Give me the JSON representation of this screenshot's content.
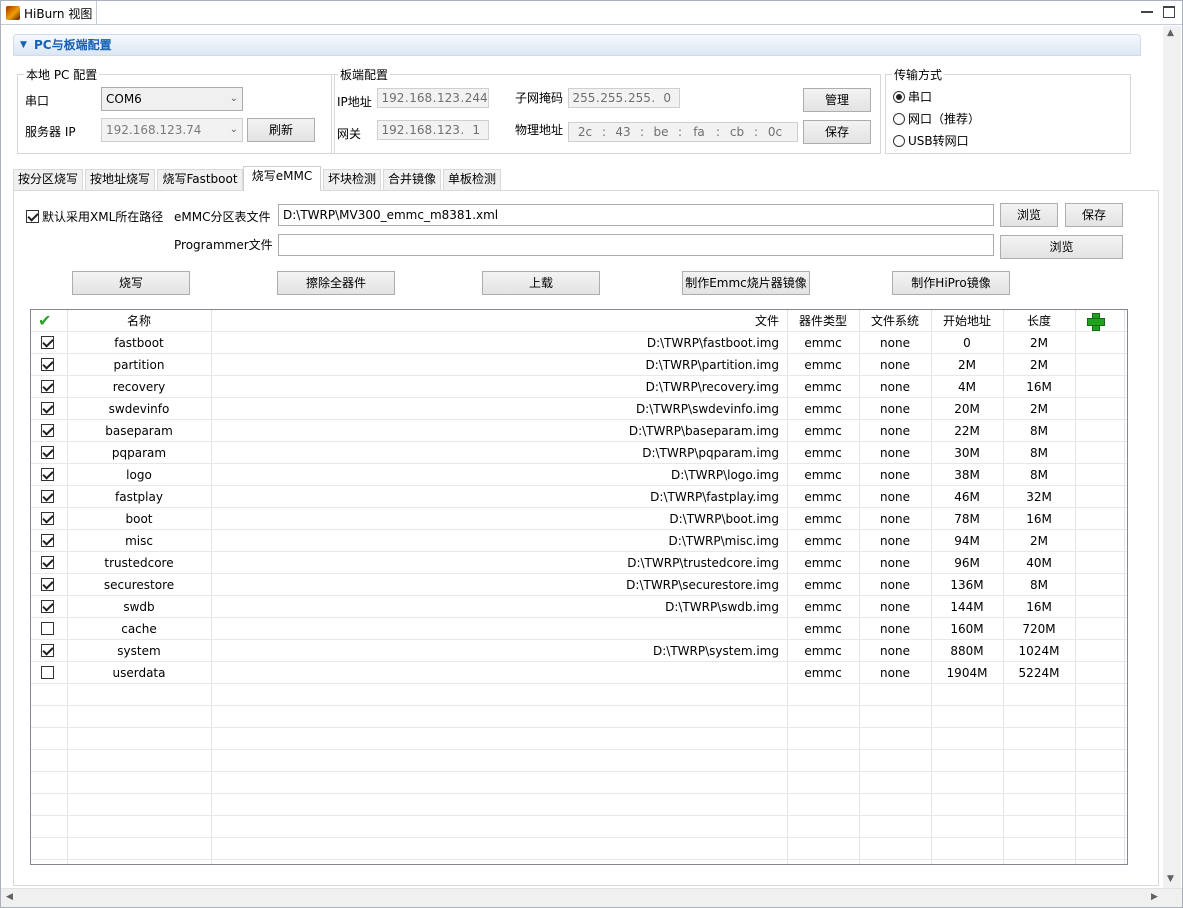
{
  "window": {
    "title": "HiBurn 视图"
  },
  "section": {
    "title": "PC与板端配置"
  },
  "local": {
    "legend": "本地 PC 配置",
    "serial_label": "串口",
    "serial_value": "COM6",
    "server_label": "服务器 IP",
    "server_value": "192.168.123.74",
    "refresh": "刷新"
  },
  "board": {
    "legend": "板端配置",
    "ip_label": "IP地址",
    "ip": [
      "192",
      "168",
      "123",
      "244"
    ],
    "gw_label": "网关",
    "gw": [
      "192",
      "168",
      "123",
      "1"
    ],
    "mask_label": "子网掩码",
    "mask": [
      "255",
      "255",
      "255",
      "0"
    ],
    "mac_label": "物理地址",
    "mac": [
      "2c",
      "43",
      "be",
      "fa",
      "cb",
      "0c"
    ],
    "manage": "管理",
    "save": "保存"
  },
  "transfer": {
    "legend": "传输方式",
    "options": [
      "串口",
      "网口（推荐）",
      "USB转网口"
    ],
    "selected": 0
  },
  "tabs": [
    "按分区烧写",
    "按地址烧写",
    "烧写Fastboot",
    "烧写eMMC",
    "坏块检测",
    "合并镜像",
    "单板检测"
  ],
  "active_tab": 3,
  "emmc": {
    "default_xml_label": "默认采用XML所在路径",
    "default_xml_checked": true,
    "table_label": "eMMC分区表文件",
    "table_value": "D:\\TWRP\\MV300_emmc_m8381.xml",
    "browse1": "浏览",
    "save": "保存",
    "programmer_label": "Programmer文件",
    "programmer_value": "",
    "browse2": "浏览",
    "actions": [
      "烧写",
      "擦除全器件",
      "上载",
      "制作Emmc烧片器镜像",
      "制作HiPro镜像"
    ]
  },
  "grid": {
    "headers": {
      "name": "名称",
      "file": "文件",
      "type": "器件类型",
      "fs": "文件系统",
      "start": "开始地址",
      "length": "长度"
    },
    "rows": [
      {
        "checked": true,
        "name": "fastboot",
        "file": "D:\\TWRP\\fastboot.img",
        "type": "emmc",
        "fs": "none",
        "start": "0",
        "length": "2M"
      },
      {
        "checked": true,
        "name": "partition",
        "file": "D:\\TWRP\\partition.img",
        "type": "emmc",
        "fs": "none",
        "start": "2M",
        "length": "2M"
      },
      {
        "checked": true,
        "name": "recovery",
        "file": "D:\\TWRP\\recovery.img",
        "type": "emmc",
        "fs": "none",
        "start": "4M",
        "length": "16M"
      },
      {
        "checked": true,
        "name": "swdevinfo",
        "file": "D:\\TWRP\\swdevinfo.img",
        "type": "emmc",
        "fs": "none",
        "start": "20M",
        "length": "2M"
      },
      {
        "checked": true,
        "name": "baseparam",
        "file": "D:\\TWRP\\baseparam.img",
        "type": "emmc",
        "fs": "none",
        "start": "22M",
        "length": "8M"
      },
      {
        "checked": true,
        "name": "pqparam",
        "file": "D:\\TWRP\\pqparam.img",
        "type": "emmc",
        "fs": "none",
        "start": "30M",
        "length": "8M"
      },
      {
        "checked": true,
        "name": "logo",
        "file": "D:\\TWRP\\logo.img",
        "type": "emmc",
        "fs": "none",
        "start": "38M",
        "length": "8M"
      },
      {
        "checked": true,
        "name": "fastplay",
        "file": "D:\\TWRP\\fastplay.img",
        "type": "emmc",
        "fs": "none",
        "start": "46M",
        "length": "32M"
      },
      {
        "checked": true,
        "name": "boot",
        "file": "D:\\TWRP\\boot.img",
        "type": "emmc",
        "fs": "none",
        "start": "78M",
        "length": "16M"
      },
      {
        "checked": true,
        "name": "misc",
        "file": "D:\\TWRP\\misc.img",
        "type": "emmc",
        "fs": "none",
        "start": "94M",
        "length": "2M"
      },
      {
        "checked": true,
        "name": "trustedcore",
        "file": "D:\\TWRP\\trustedcore.img",
        "type": "emmc",
        "fs": "none",
        "start": "96M",
        "length": "40M"
      },
      {
        "checked": true,
        "name": "securestore",
        "file": "D:\\TWRP\\securestore.img",
        "type": "emmc",
        "fs": "none",
        "start": "136M",
        "length": "8M"
      },
      {
        "checked": true,
        "name": "swdb",
        "file": "D:\\TWRP\\swdb.img",
        "type": "emmc",
        "fs": "none",
        "start": "144M",
        "length": "16M"
      },
      {
        "checked": false,
        "name": "cache",
        "file": "",
        "type": "emmc",
        "fs": "none",
        "start": "160M",
        "length": "720M"
      },
      {
        "checked": true,
        "name": "system",
        "file": "D:\\TWRP\\system.img",
        "type": "emmc",
        "fs": "none",
        "start": "880M",
        "length": "1024M"
      },
      {
        "checked": false,
        "name": "userdata",
        "file": "",
        "type": "emmc",
        "fs": "none",
        "start": "1904M",
        "length": "5224M"
      }
    ]
  }
}
